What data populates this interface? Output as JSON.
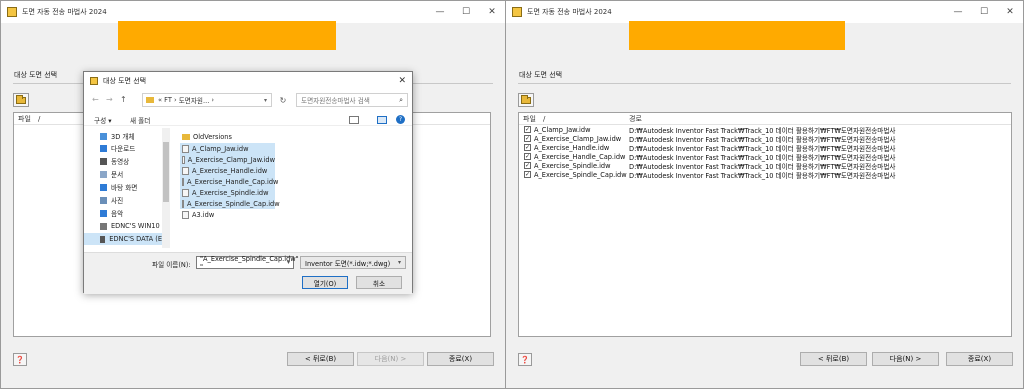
{
  "left_window": {
    "title": "도면 자동 전송 마법사 2024",
    "window_controls": [
      "—",
      "☐",
      "✕"
    ],
    "section_label": "대상 도면 선택",
    "list_header": {
      "file": "파일",
      "sort": "/"
    },
    "buttons": {
      "back": "< 뒤로(B)",
      "next": "다음(N) >",
      "close": "종료(X)"
    }
  },
  "file_dialog": {
    "title": "대상 도면 선택",
    "close": "✕",
    "nav_back": "←",
    "nav_forward": "→",
    "nav_up": "↑",
    "address": [
      "«",
      "FT",
      "›",
      "도면자원...",
      "›"
    ],
    "search_placeholder": "도면자원전송마법사 검색",
    "organize": "구성 ▾",
    "new_folder": "새 폴더",
    "nav_items": [
      {
        "label": "3D 개체",
        "icon_color": "#4a90d9"
      },
      {
        "label": "다운로드",
        "icon_color": "#2e7bd6"
      },
      {
        "label": "동영상",
        "icon_color": "#555555"
      },
      {
        "label": "문서",
        "icon_color": "#8aa6c8"
      },
      {
        "label": "바탕 화면",
        "icon_color": "#2e7bd6"
      },
      {
        "label": "사진",
        "icon_color": "#6a8fb8"
      },
      {
        "label": "음악",
        "icon_color": "#2e7bd6"
      },
      {
        "label": "EDNC'S WIN10 (",
        "icon_color": "#777777"
      },
      {
        "label": "EDNC'S DATA (E",
        "icon_color": "#555555"
      }
    ],
    "files": [
      {
        "name": "OldVersions",
        "type": "folder",
        "selected": false
      },
      {
        "name": "A_Clamp_Jaw.idw",
        "type": "file",
        "selected": true
      },
      {
        "name": "A_Exercise_Clamp_Jaw.idw",
        "type": "file",
        "selected": true
      },
      {
        "name": "A_Exercise_Handle.idw",
        "type": "file",
        "selected": true
      },
      {
        "name": "A_Exercise_Handle_Cap.idw",
        "type": "file",
        "selected": true
      },
      {
        "name": "A_Exercise_Spindle.idw",
        "type": "file",
        "selected": true
      },
      {
        "name": "A_Exercise_Spindle_Cap.idw",
        "type": "file",
        "selected": true
      },
      {
        "name": "A3.idw",
        "type": "file",
        "selected": false
      }
    ],
    "filename_label": "파일 이름(N):",
    "filename_value": "\"A_Exercise_Spindle_Cap.idw\" \"",
    "filetype": "Inventor 도면(*.idw;*.dwg)",
    "open_button": "열기(O)",
    "cancel_button": "취소"
  },
  "right_window": {
    "title": "도면 자동 전송 마법사 2024",
    "window_controls": [
      "—",
      "☐",
      "✕"
    ],
    "section_label": "대상 도면 선택",
    "list_header": {
      "file": "파일",
      "sort": "/",
      "path": "경로"
    },
    "rows": [
      {
        "name": "A_Clamp_Jaw.idw",
        "path": "D:₩Autodesk Inventor Fast Track₩Track_10 데이터 활용하기₩FT₩도면자원전송마법사"
      },
      {
        "name": "A_Exercise_Clamp_Jaw.idw",
        "path": "D:₩Autodesk Inventor Fast Track₩Track_10 데이터 활용하기₩FT₩도면자원전송마법사"
      },
      {
        "name": "A_Exercise_Handle.idw",
        "path": "D:₩Autodesk Inventor Fast Track₩Track_10 데이터 활용하기₩FT₩도면자원전송마법사"
      },
      {
        "name": "A_Exercise_Handle_Cap.idw",
        "path": "D:₩Autodesk Inventor Fast Track₩Track_10 데이터 활용하기₩FT₩도면자원전송마법사"
      },
      {
        "name": "A_Exercise_Spindle.idw",
        "path": "D:₩Autodesk Inventor Fast Track₩Track_10 데이터 활용하기₩FT₩도면자원전송마법사"
      },
      {
        "name": "A_Exercise_Spindle_Cap.idw",
        "path": "D:₩Autodesk Inventor Fast Track₩Track_10 데이터 활용하기₩FT₩도면자원전송마법사"
      }
    ],
    "buttons": {
      "back": "< 뒤로(B)",
      "next": "다음(N) >",
      "close": "종료(X)"
    }
  },
  "colors": {
    "banner": "#ffaa00",
    "selection": "#cce4f7",
    "accent": "#1f6fc5"
  }
}
